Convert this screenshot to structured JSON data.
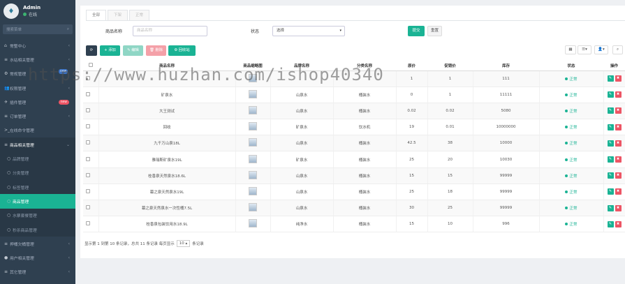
{
  "colors": {
    "sidebar_bg": "#2f4050",
    "accent": "#1ab394",
    "danger": "#ed5565",
    "status_green": "#1ab394"
  },
  "sidebar": {
    "user_name": "Admin",
    "user_status": "在线",
    "search_placeholder": "搜索菜单",
    "items": [
      {
        "label": "常整中心",
        "icon": "home-icon",
        "arrow": "‹"
      },
      {
        "label": "水站相关管理",
        "icon": "list-icon",
        "arrow": "‹"
      },
      {
        "label": "常规管理",
        "icon": "gear-icon",
        "badge": "new"
      },
      {
        "label": "权限管理",
        "icon": "users-icon",
        "arrow": "‹"
      },
      {
        "label": "插件管理",
        "icon": "rocket-icon",
        "badge": "new"
      },
      {
        "label": "订单管理",
        "icon": "list-icon",
        "arrow": "‹"
      },
      {
        "label": "在线命令管理",
        "icon": "terminal-icon",
        "arrow": ""
      },
      {
        "label": "商品相关管理",
        "icon": "list-icon",
        "arrow": "⌄",
        "open": true
      },
      {
        "label": "品牌管理",
        "icon": "circle-icon",
        "sub": true
      },
      {
        "label": "分类管理",
        "icon": "circle-icon",
        "sub": true
      },
      {
        "label": "标签管理",
        "icon": "circle-icon",
        "sub": true
      },
      {
        "label": "商品管理",
        "icon": "circle-icon",
        "sub": true,
        "active": true
      },
      {
        "label": "水票套餐管理",
        "icon": "circle-icon",
        "sub": true
      },
      {
        "label": "秒杀商品管理",
        "icon": "circle-icon",
        "sub": true
      },
      {
        "label": "押桶欠桶管理",
        "icon": "list-icon",
        "arrow": "‹"
      },
      {
        "label": "用户相关管理",
        "icon": "user-icon",
        "arrow": "‹"
      },
      {
        "label": "其它管理",
        "icon": "list-icon",
        "arrow": "‹"
      }
    ]
  },
  "tabs": [
    "全部",
    "下架",
    "正常"
  ],
  "filter": {
    "name_label": "商品名称",
    "name_placeholder": "商品名称",
    "status_label": "状态",
    "status_value": "选择",
    "submit_label": "提交",
    "reset_label": "重置"
  },
  "toolbar": {
    "refresh_icon": "refresh-icon",
    "add_label": "+ 添加",
    "edit_label": "✎ 编辑",
    "delete_label": "🗑 删除",
    "recycle_label": "⚙ 回收站"
  },
  "table": {
    "headers": [
      "",
      "商品名称",
      "商品缩略图",
      "品牌名称",
      "分类名称",
      "原价",
      "促销价",
      "库存",
      "状态",
      "操作"
    ],
    "rows": [
      {
        "name": "",
        "brand": "",
        "category": "",
        "price": "1",
        "promo": "1",
        "stock": "111",
        "status": "正常"
      },
      {
        "name": "矿泉水",
        "brand": "山泉水",
        "category": "桶装水",
        "price": "0",
        "promo": "1",
        "stock": "11111",
        "status": "正常"
      },
      {
        "name": "大王测试",
        "brand": "山泉水",
        "category": "桶装水",
        "price": "0.02",
        "promo": "0.02",
        "stock": "5080",
        "status": "正常"
      },
      {
        "name": "回收",
        "brand": "矿泉水",
        "category": "饮水机",
        "price": "19",
        "promo": "0.01",
        "stock": "10000000",
        "status": "正常"
      },
      {
        "name": "九千万山泉18L",
        "brand": "山泉水",
        "category": "桶装水",
        "price": "42.5",
        "promo": "38",
        "stock": "10000",
        "status": "正常"
      },
      {
        "name": "雅瑞斯矿泉水19L",
        "brand": "矿泉水",
        "category": "桶装水",
        "price": "25",
        "promo": "20",
        "stock": "10030",
        "status": "正常"
      },
      {
        "name": "桂香泉天然泉水18.6L",
        "brand": "山泉水",
        "category": "桶装水",
        "price": "15",
        "promo": "15",
        "stock": "99999",
        "status": "正常"
      },
      {
        "name": "幕之泉天然泉水19L",
        "brand": "山泉水",
        "category": "桶装水",
        "price": "25",
        "promo": "18",
        "stock": "99999",
        "status": "正常"
      },
      {
        "name": "幕之泉天然泉水一次性桶7.5L",
        "brand": "山泉水",
        "category": "桶装水",
        "price": "30",
        "promo": "25",
        "stock": "99999",
        "status": "正常"
      },
      {
        "name": "桂香泉包装饮用水18.9L",
        "brand": "纯净水",
        "category": "桶装水",
        "price": "15",
        "promo": "10",
        "stock": "996",
        "status": "正常"
      }
    ]
  },
  "pager": {
    "summary": "显示第 1 到第 10 条记录，总共 11 条记录 每页显示",
    "page_size": "10 ▴",
    "suffix": "条记录"
  },
  "watermark": "https://www.huzhan.com/ishop40340"
}
